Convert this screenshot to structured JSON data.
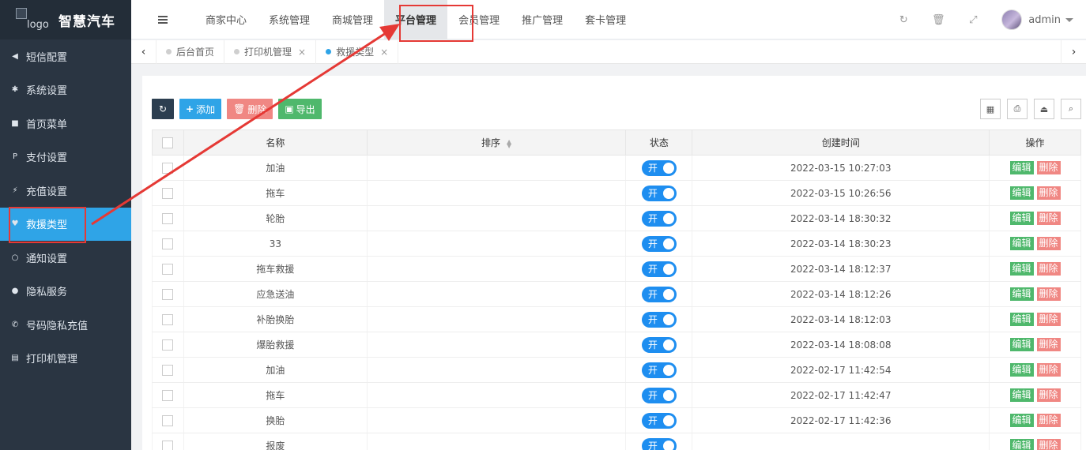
{
  "logo": {
    "alt": "logo",
    "title": "智慧汽车"
  },
  "sidebar": {
    "items": [
      {
        "label": "短信配置",
        "icon": "bullhorn-icon",
        "glyph": "◀"
      },
      {
        "label": "系统设置",
        "icon": "gear-icon",
        "glyph": "✱"
      },
      {
        "label": "首页菜单",
        "icon": "bookmark-icon",
        "glyph": "■"
      },
      {
        "label": "支付设置",
        "icon": "paypal-icon",
        "glyph": "P"
      },
      {
        "label": "充值设置",
        "icon": "cc-icon",
        "glyph": "⚡"
      },
      {
        "label": "救援类型",
        "icon": "heart-icon",
        "glyph": "♥"
      },
      {
        "label": "通知设置",
        "icon": "circle-icon",
        "glyph": "○"
      },
      {
        "label": "隐私服务",
        "icon": "product-hunt-icon",
        "glyph": "●"
      },
      {
        "label": "号码隐私充值",
        "icon": "phone-icon",
        "glyph": "✆"
      },
      {
        "label": "打印机管理",
        "icon": "print-icon",
        "glyph": "▤"
      }
    ]
  },
  "header": {
    "nav": [
      "商家中心",
      "系统管理",
      "商城管理",
      "平台管理",
      "会员管理",
      "推广管理",
      "套卡管理"
    ],
    "user": "admin"
  },
  "tabs": [
    {
      "label": "后台首页",
      "closable": false
    },
    {
      "label": "打印机管理",
      "closable": true
    },
    {
      "label": "救援类型",
      "closable": true
    }
  ],
  "toolbar": {
    "add": "添加",
    "delete": "删除",
    "export": "导出"
  },
  "table": {
    "columns": [
      "名称",
      "排序",
      "状态",
      "创建时间",
      "操作"
    ],
    "switch_on": "开",
    "edit": "编辑",
    "delete": "删除",
    "rows": [
      {
        "name": "加油",
        "time": "2022-03-15 10:27:03"
      },
      {
        "name": "拖车",
        "time": "2022-03-15 10:26:56"
      },
      {
        "name": "轮胎",
        "time": "2022-03-14 18:30:32"
      },
      {
        "name": "33",
        "time": "2022-03-14 18:30:23"
      },
      {
        "name": "拖车救援",
        "time": "2022-03-14 18:12:37"
      },
      {
        "name": "应急送油",
        "time": "2022-03-14 18:12:26"
      },
      {
        "name": "补胎换胎",
        "time": "2022-03-14 18:12:03"
      },
      {
        "name": "爆胎救援",
        "time": "2022-03-14 18:08:08"
      },
      {
        "name": "加油",
        "time": "2022-02-17 11:42:54"
      },
      {
        "name": "拖车",
        "time": "2022-02-17 11:42:47"
      },
      {
        "name": "换胎",
        "time": "2022-02-17 11:42:36"
      },
      {
        "name": "报废",
        "time": ""
      }
    ]
  },
  "colors": {
    "sidebar_bg": "#2a3542",
    "accent": "#2fa4e7",
    "annotation": "#e53935"
  }
}
